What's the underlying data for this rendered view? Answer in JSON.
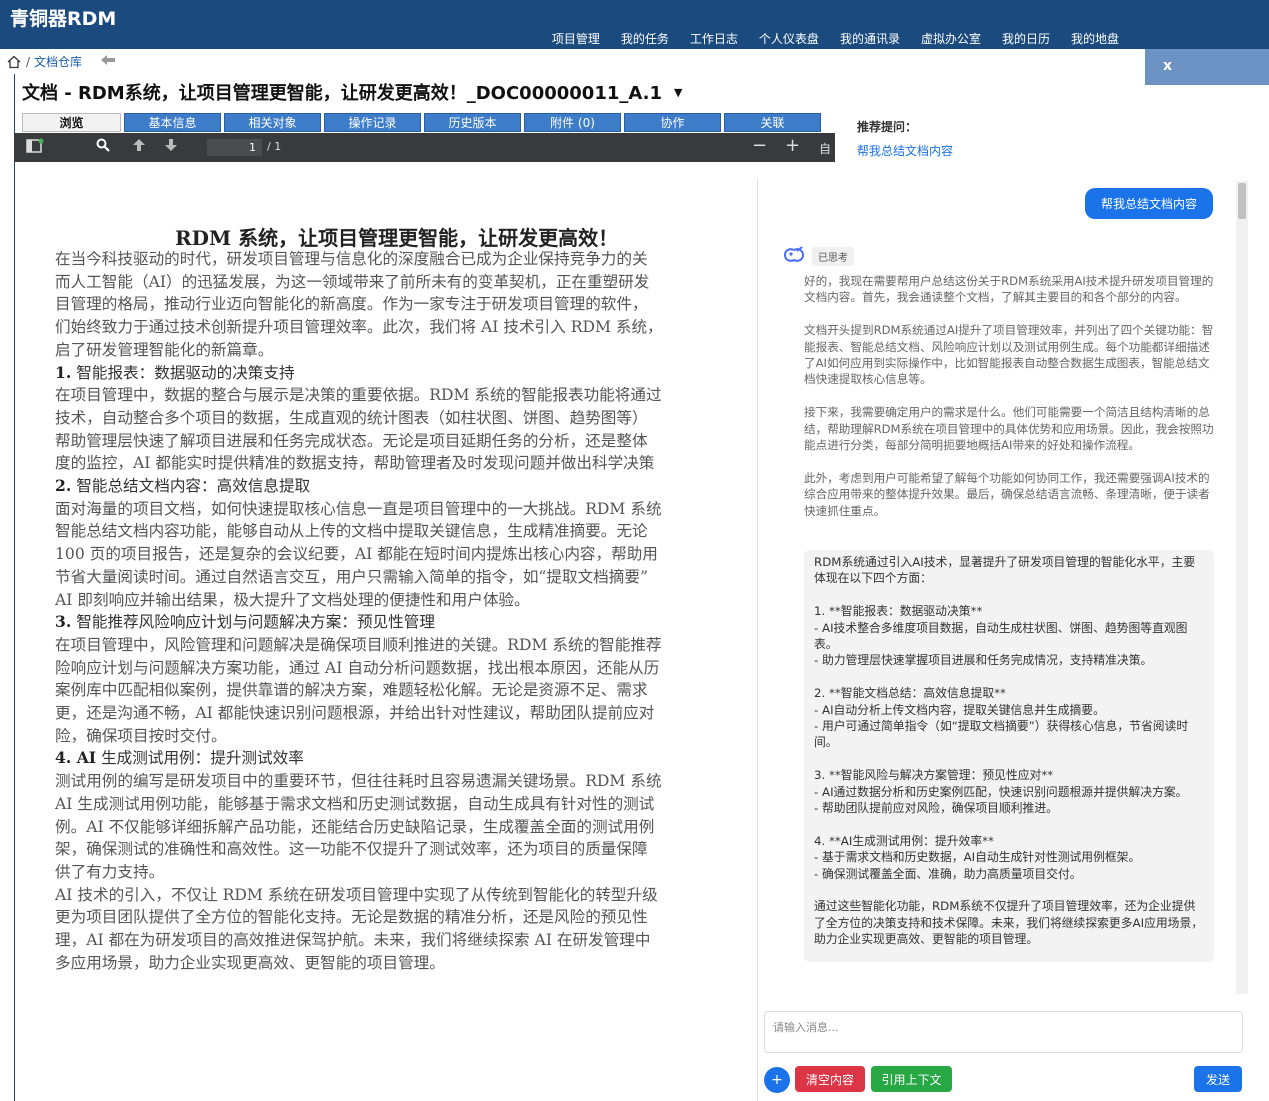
{
  "app": {
    "logo": "青铜器RDM"
  },
  "nav": [
    "项目管理",
    "我的任务",
    "工作日志",
    "个人仪表盘",
    "我的通讯录",
    "虚拟办公室",
    "我的日历",
    "我的地盘"
  ],
  "breadcrumb": {
    "sep": "/",
    "current": "文档仓库"
  },
  "document": {
    "title": "文档 - RDM系统，让项目管理更智能，让研发更高效！_DOC00000011_A.1"
  },
  "tabs": [
    {
      "label": "浏览"
    },
    {
      "label": "基本信息"
    },
    {
      "label": "相关对象"
    },
    {
      "label": "操作记录"
    },
    {
      "label": "历史版本"
    },
    {
      "label": "附件 (0)"
    },
    {
      "label": "协作"
    },
    {
      "label": "关联"
    }
  ],
  "viewer": {
    "page": "1",
    "total": "/ 1",
    "zoom_label": "自"
  },
  "pdf": {
    "title": "RDM 系统，让项目管理更智能，让研发更高效！",
    "lines": [
      "在当今科技驱动的时代，研发项目管理与信息化的深度融合已成为企业保持竞争力的关",
      "而人工智能（AI）的迅猛发展，为这一领域带来了前所未有的变革契机，正在重塑研发",
      "目管理的格局，推动行业迈向智能化的新高度。作为一家专注于研发项目管理的软件，",
      "们始终致力于通过技术创新提升项目管理效率。此次，我们将 AI 技术引入 RDM 系统，",
      "启了研发管理智能化的新篇章。",
      "1. 智能报表：数据驱动的决策支持",
      "在项目管理中，数据的整合与展示是决策的重要依据。RDM 系统的智能报表功能将通过",
      "技术，自动整合多个项目的数据，生成直观的统计图表（如柱状图、饼图、趋势图等）",
      "帮助管理层快速了解项目进展和任务完成状态。无论是项目延期任务的分析，还是整体",
      "度的监控，AI 都能实时提供精准的数据支持，帮助管理者及时发现问题并做出科学决策",
      "2. 智能总结文档内容：高效信息提取",
      "面对海量的项目文档，如何快速提取核心信息一直是项目管理中的一大挑战。RDM 系统",
      "智能总结文档内容功能，能够自动从上传的文档中提取关键信息，生成精准摘要。无论",
      "100 页的项目报告，还是复杂的会议纪要，AI 都能在短时间内提炼出核心内容，帮助用",
      "节省大量阅读时间。通过自然语言交互，用户只需输入简单的指令，如“提取文档摘要”",
      "AI 即刻响应并输出结果，极大提升了文档处理的便捷性和用户体验。",
      "3. 智能推荐风险响应计划与问题解决方案：预见性管理",
      "在项目管理中，风险管理和问题解决是确保项目顺利推进的关键。RDM 系统的智能推荐",
      "险响应计划与问题解决方案功能，通过 AI 自动分析问题数据，找出根本原因，还能从历",
      "案例库中匹配相似案例，提供靠谱的解决方案，难题轻松化解。无论是资源不足、需求",
      "更，还是沟通不畅，AI 都能快速识别问题根源，并给出针对性建议，帮助团队提前应对",
      "险，确保项目按时交付。",
      "4. AI 生成测试用例：提升测试效率",
      "测试用例的编写是研发项目中的重要环节，但往往耗时且容易遗漏关键场景。RDM 系统",
      "AI 生成测试用例功能，能够基于需求文档和历史测试数据，自动生成具有针对性的测试",
      "例。AI 不仅能够详细拆解产品功能，还能结合历史缺陷记录，生成覆盖全面的测试用例",
      "架，确保测试的准确性和高效性。这一功能不仅提升了测试效率，还为项目的质量保障",
      "供了有力支持。",
      "AI 技术的引入，不仅让 RDM 系统在研发项目管理中实现了从传统到智能化的转型升级",
      "更为项目团队提供了全方位的智能化支持。无论是数据的精准分析，还是风险的预见性",
      "理，AI 都在为研发项目的高效推进保驾护航。未来，我们将继续探索 AI 在研发管理中",
      "多应用场景，助力企业实现更高效、更智能的项目管理。"
    ],
    "headings": {
      "h1": [
        "1.",
        "智能报表：数据驱动的决策支持"
      ],
      "h2": [
        "2.",
        "智能总结文档内容：高效信息提取"
      ],
      "h3": [
        "3.",
        "智能推荐风险响应计划与问题解决方案：预见性管理"
      ],
      "h4": [
        "4. AI",
        "生成测试用例：提升测试效率"
      ]
    }
  },
  "panel": {
    "close": "x",
    "recommend_label": "推荐提问：",
    "recommend_link": "帮我总结文档内容"
  },
  "chat": {
    "user_message": "帮我总结文档内容",
    "think_badge": "已思考",
    "thinking": [
      "好的，我现在需要帮用户总结这份关于RDM系统采用AI技术提升研发项目管理的文档内容。首先，我会通读整个文档，了解其主要目的和各个部分的内容。",
      "文档开头提到RDM系统通过AI提升了项目管理效率，并列出了四个关键功能：智能报表、智能总结文档、风险响应计划以及测试用例生成。每个功能都详细描述了AI如何应用到实际操作中，比如智能报表自动整合数据生成图表，智能总结文档快速提取核心信息等。",
      "接下来，我需要确定用户的需求是什么。他们可能需要一个简洁且结构清晰的总结，帮助理解RDM系统在项目管理中的具体优势和应用场景。因此，我会按照功能点进行分类，每部分简明扼要地概括AI带来的好处和操作流程。",
      "此外，考虑到用户可能希望了解每个功能如何协同工作，我还需要强调AI技术的综合应用带来的整体提升效果。最后，确保总结语言流畅、条理清晰，便于读者快速抓住重点。"
    ],
    "answer": [
      "RDM系统通过引入AI技术，显著提升了研发项目管理的智能化水平，主要体现在以下四个方面：",
      "",
      "1. **智能报表：数据驱动决策**",
      "  - AI技术整合多维度项目数据，自动生成柱状图、饼图、趋势图等直观图表。",
      "  - 助力管理层快速掌握项目进展和任务完成情况，支持精准决策。",
      "",
      "2. **智能文档总结：高效信息提取**",
      "  - AI自动分析上传文档内容，提取关键信息并生成摘要。",
      "  - 用户可通过简单指令（如“提取文档摘要”）获得核心信息，节省阅读时间。",
      "",
      "3. **智能风险与解决方案管理：预见性应对**",
      "  - AI通过数据分析和历史案例匹配，快速识别问题根源并提供解决方案。",
      "  - 帮助团队提前应对风险，确保项目顺利推进。",
      "",
      "4. **AI生成测试用例：提升效率**",
      "  - 基于需求文档和历史数据，AI自动生成针对性测试用例框架。",
      "  - 确保测试覆盖全面、准确，助力高质量项目交付。",
      "",
      "通过这些智能化功能，RDM系统不仅提升了项目管理效率，还为企业提供了全方位的决策支持和技术保障。未来，我们将继续探索更多AI应用场景，助力企业实现更高效、更智能的项目管理。"
    ],
    "input_placeholder": "请输入消息...",
    "buttons": {
      "plus": "+",
      "clear": "清空内容",
      "context": "引用上下文",
      "send": "发送"
    }
  },
  "colors": {
    "header": "#1a4a7e",
    "tab": "#3d7cc9",
    "primary": "#1a73e8",
    "danger": "#dc3545",
    "success": "#28a745"
  }
}
